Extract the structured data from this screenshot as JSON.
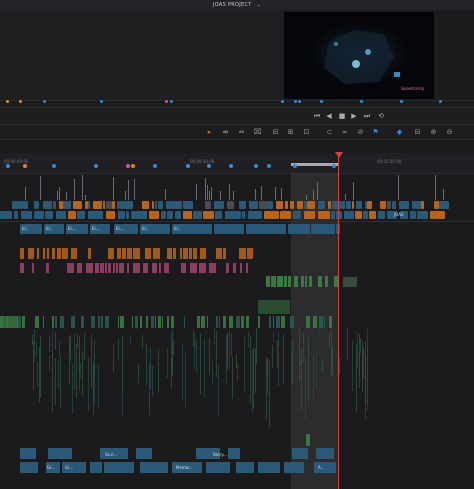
{
  "project": {
    "title": "JOAS PROJECT",
    "dropdown_icon": "chevron-down-icon"
  },
  "viewer": {
    "overlay_text": "Speedramp"
  },
  "transport": {
    "buttons": [
      {
        "name": "skip-to-start-button",
        "glyph": "⏮"
      },
      {
        "name": "step-back-button",
        "glyph": "◀"
      },
      {
        "name": "stop-button",
        "glyph": "■"
      },
      {
        "name": "play-button",
        "glyph": "▶"
      },
      {
        "name": "skip-to-end-button",
        "glyph": "⏭"
      },
      {
        "name": "loop-button",
        "glyph": "⟲"
      }
    ]
  },
  "toolbar": {
    "tools": [
      {
        "name": "selection-tool-icon",
        "glyph": "▸"
      },
      {
        "name": "trim-tool-icon",
        "glyph": "⇹"
      },
      {
        "name": "dynamic-trim-icon",
        "glyph": "⇔"
      },
      {
        "name": "blade-tool-icon",
        "glyph": "⌧"
      },
      {
        "name": "insert-clip-icon",
        "glyph": "⊟"
      },
      {
        "name": "overwrite-clip-icon",
        "glyph": "⊞"
      },
      {
        "name": "replace-clip-icon",
        "glyph": "⊡"
      },
      {
        "name": "snapping-icon",
        "glyph": "⊂"
      },
      {
        "name": "linked-selection-icon",
        "glyph": "∞"
      },
      {
        "name": "position-lock-icon",
        "glyph": "⊘"
      },
      {
        "name": "flag-icon",
        "glyph": "⚑"
      },
      {
        "name": "marker-icon",
        "glyph": "◆"
      },
      {
        "name": "zoom-detail-icon",
        "glyph": "⊟"
      },
      {
        "name": "zoom-custom-icon",
        "glyph": "⊕"
      },
      {
        "name": "zoom-full-icon",
        "glyph": "⊖"
      }
    ]
  },
  "ruler": {
    "timecodes": [
      "00:00:00:00",
      "00:00:30:00",
      "00:01:00:00"
    ]
  },
  "colors": {
    "accent_blue": "#2f8fd8",
    "playhead_red": "#d8403a",
    "clip_video": "#2a5a78",
    "clip_orange": "#b8651c",
    "clip_pink": "#a0446e",
    "clip_green": "#3a7a40",
    "marker_orange": "#e08a1e",
    "marker_pink": "#d050b0"
  },
  "video_clip_labels": [
    "El...",
    "El...",
    "El...",
    "El...",
    "El...",
    "El...",
    "El..."
  ],
  "misc_clip_labels": [
    "JOAS",
    "Gr...",
    "Gr...",
    "Se.il...",
    "Memor...",
    "Story...",
    "A..."
  ]
}
